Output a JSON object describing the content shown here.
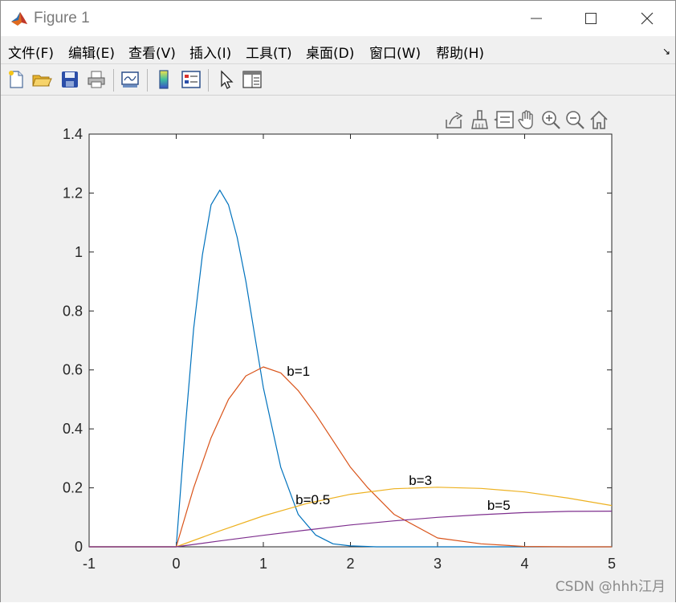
{
  "window": {
    "title": "Figure 1",
    "minimize_glyph": "—",
    "maximize_glyph": "☐",
    "close_glyph": "✕"
  },
  "menu": {
    "items": [
      "文件(F)",
      "编辑(E)",
      "查看(V)",
      "插入(I)",
      "工具(T)",
      "桌面(D)",
      "窗口(W)",
      "帮助(H)"
    ],
    "dock_glyph": "↘"
  },
  "toolbar": {
    "icons": [
      "new-figure-icon",
      "open-file-icon",
      "save-icon",
      "print-icon",
      "link-plot-icon",
      "insert-colorbar-icon",
      "insert-legend-icon",
      "edit-plot-arrow-icon",
      "property-inspector-icon"
    ]
  },
  "axes_toolbar": {
    "icons": [
      "export-icon",
      "brush-icon",
      "data-tips-icon",
      "pan-hand-icon",
      "zoom-in-icon",
      "zoom-out-icon",
      "home-icon"
    ]
  },
  "chart_data": {
    "type": "line",
    "title": "",
    "xlabel": "",
    "ylabel": "",
    "xlim": [
      -1,
      5
    ],
    "ylim": [
      0,
      1.4
    ],
    "xticks": [
      "-1",
      "0",
      "1",
      "2",
      "3",
      "4",
      "5"
    ],
    "yticks": [
      "0",
      "0.2",
      "0.4",
      "0.6",
      "0.8",
      "1",
      "1.2",
      "1.4"
    ],
    "grid": false,
    "legend": "none",
    "series": [
      {
        "color": "#0072bd",
        "x": [
          -1,
          0,
          0.1,
          0.2,
          0.3,
          0.4,
          0.5,
          0.6,
          0.7,
          0.8,
          0.9,
          1.0,
          1.2,
          1.4,
          1.6,
          1.8,
          2.0,
          2.3,
          2.6,
          3.0,
          4.0,
          5.0
        ],
        "values": [
          0,
          0,
          0.39,
          0.74,
          0.99,
          1.16,
          1.21,
          1.16,
          1.05,
          0.9,
          0.72,
          0.54,
          0.27,
          0.11,
          0.04,
          0.01,
          0.003,
          0,
          0,
          0,
          0,
          0
        ]
      },
      {
        "color": "#d95319",
        "x": [
          -1,
          0,
          0.2,
          0.4,
          0.6,
          0.8,
          1.0,
          1.2,
          1.4,
          1.6,
          1.8,
          2.0,
          2.2,
          2.5,
          3.0,
          3.5,
          4.0,
          4.5,
          5.0
        ],
        "values": [
          0,
          0,
          0.2,
          0.37,
          0.5,
          0.58,
          0.61,
          0.59,
          0.53,
          0.45,
          0.36,
          0.27,
          0.2,
          0.11,
          0.03,
          0.01,
          0.001,
          0,
          0
        ]
      },
      {
        "color": "#edb120",
        "x": [
          -1,
          0,
          0.5,
          1.0,
          1.5,
          2.0,
          2.5,
          3.0,
          3.5,
          4.0,
          4.5,
          5.0
        ],
        "values": [
          0,
          0,
          0.054,
          0.105,
          0.147,
          0.178,
          0.197,
          0.202,
          0.198,
          0.186,
          0.165,
          0.14
        ]
      },
      {
        "color": "#7e2f8e",
        "x": [
          -1,
          0,
          0.5,
          1.0,
          1.5,
          2.0,
          2.5,
          3.0,
          3.5,
          4.0,
          4.5,
          5.0
        ],
        "values": [
          0,
          0,
          0.02,
          0.039,
          0.057,
          0.074,
          0.088,
          0.1,
          0.109,
          0.116,
          0.12,
          0.121
        ]
      }
    ],
    "annotations": [
      {
        "text": "b=1",
        "x": 1.27,
        "y": 0.58
      },
      {
        "text": "b=0.5",
        "x": 1.37,
        "y": 0.145
      },
      {
        "text": "b=3",
        "x": 2.67,
        "y": 0.21
      },
      {
        "text": "b=5",
        "x": 3.57,
        "y": 0.125
      }
    ]
  },
  "watermark": "CSDN @hhh江月"
}
